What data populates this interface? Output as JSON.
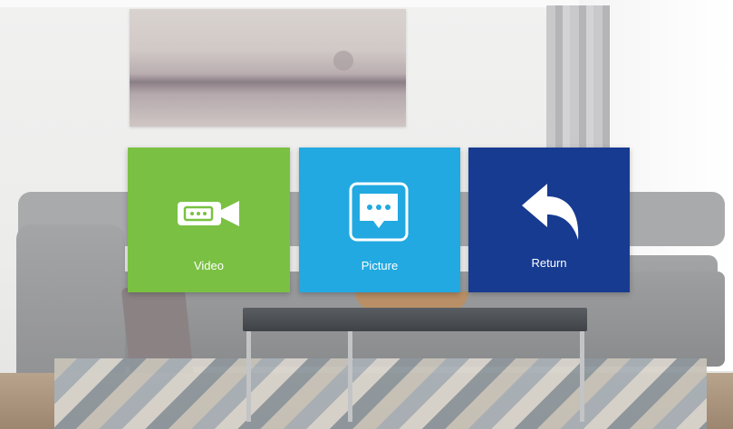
{
  "menu": {
    "tiles": [
      {
        "label": "Video",
        "icon": "video-camera-icon",
        "color": "#7ac143"
      },
      {
        "label": "Picture",
        "icon": "picture-message-icon",
        "color": "#22a9e1"
      },
      {
        "label": "Return",
        "icon": "return-arrow-icon",
        "color": "#173b91"
      }
    ]
  },
  "colors": {
    "tile_text": "#ffffff"
  }
}
